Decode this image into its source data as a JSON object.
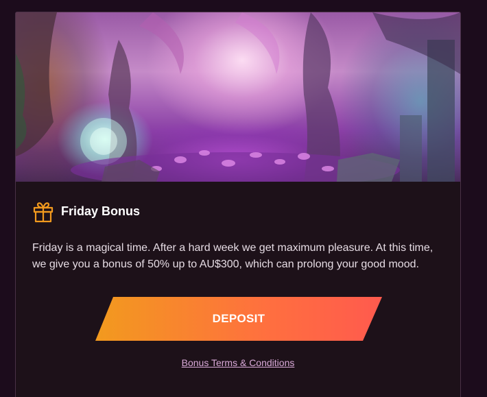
{
  "promo": {
    "title": "Friday Bonus",
    "description": "Friday is a magical time. After a hard week we get maximum pleasure. At this time, we give you a bonus of 50% up to AU$300, which can prolong your good mood.",
    "icon": "gift-icon",
    "image": "enchanted-jungle-banner",
    "button_label": "DEPOSIT",
    "terms_label": "Bonus Terms & Conditions"
  },
  "colors": {
    "page_background": "#1c0c1c",
    "card_background": "#1d1119",
    "card_border": "#4a3147",
    "icon_accent": "#f29a1e",
    "button_gradient_start": "#f29a1e",
    "button_gradient_end": "#ff5a4e",
    "terms_link": "#d9a9d8"
  }
}
